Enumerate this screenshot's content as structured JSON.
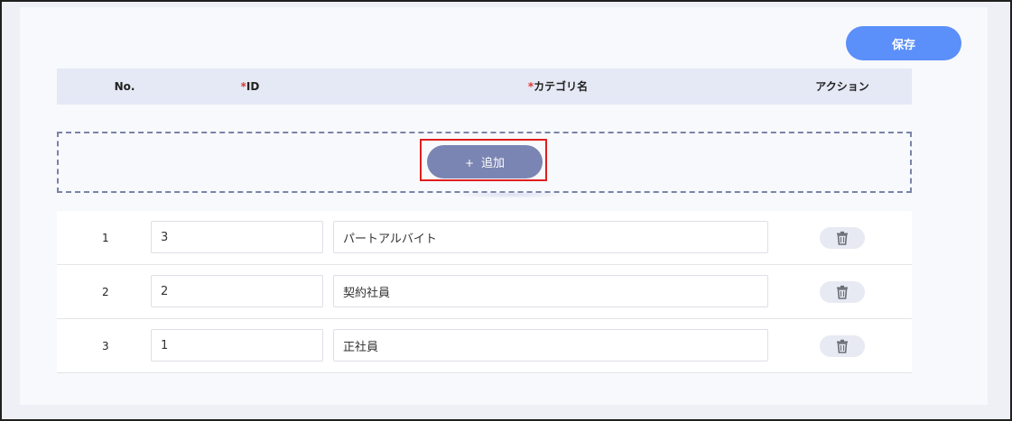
{
  "toolbar": {
    "save_label": "保存"
  },
  "table": {
    "headers": {
      "no": "No.",
      "id_required_mark": "*",
      "id": "ID",
      "name_required_mark": "*",
      "name": "カテゴリ名",
      "action": "アクション"
    },
    "add_label": "追加",
    "add_icon": "+",
    "rows": [
      {
        "no": "1",
        "id": "3",
        "name": "パートアルバイト",
        "action_icon": "trash-icon"
      },
      {
        "no": "2",
        "id": "2",
        "name": "契約社員",
        "action_icon": "trash-icon"
      },
      {
        "no": "3",
        "id": "1",
        "name": "正社員",
        "action_icon": "trash-icon"
      }
    ]
  },
  "colors": {
    "save_button": "#5b8ff9",
    "add_button": "#7b85b3",
    "header_bg": "#e5e8f5",
    "highlight": "#e01e1e",
    "required_mark": "#e0342f"
  }
}
